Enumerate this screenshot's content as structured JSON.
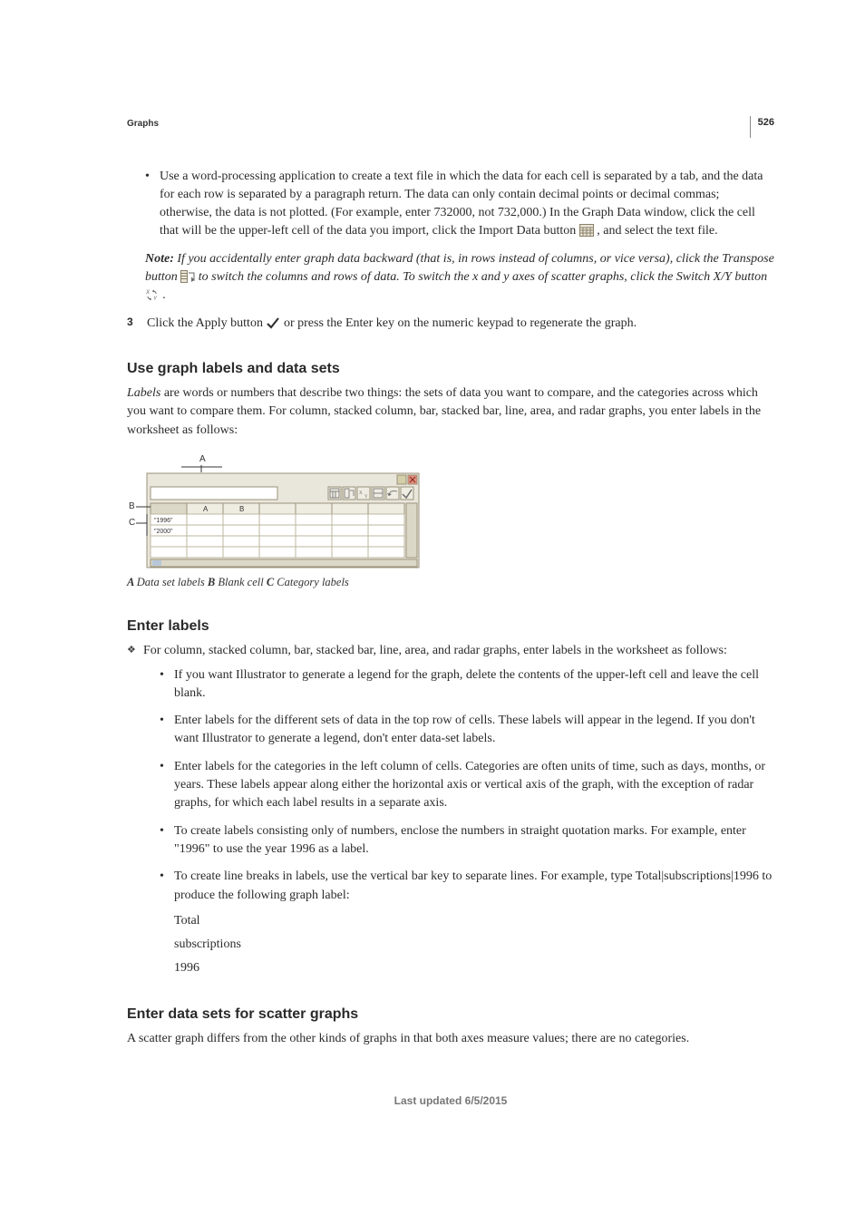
{
  "page_number": "526",
  "section_tag": "Graphs",
  "top_bullet": {
    "text_a": "Use a word-processing application to create a text file in which the data for each cell is separated by a tab, and the data for each row is separated by a paragraph return. The data can only contain decimal points or decimal commas; otherwise, the data is not plotted. (For example, enter 732000, not 732,000.) In the Graph Data window, click the cell that will be the upper-left cell of the data you import, click the Import Data button ",
    "text_b": ", and select the text file."
  },
  "note": {
    "label": "Note: ",
    "line1_a": "If you accidentally enter graph data backward (that is, in rows instead of columns, or vice versa), click the Transpose button ",
    "line1_b": " to switch the columns and rows of data. To switch the x and y axes of scatter graphs, click the Switch X/Y button ",
    "line1_c": " ."
  },
  "step3": {
    "num": "3",
    "text_a": "Click the Apply button ",
    "text_b": " or press the Enter key on the numeric keypad to regenerate the graph."
  },
  "h_use": "Use graph labels and data sets",
  "p_labels": {
    "term": "Labels",
    "rest": " are words or numbers that describe two things: the sets of data you want to compare, and the categories across which you want to compare them. For column, stacked column, bar, stacked bar, line, area, and radar graphs, you enter labels in the worksheet as follows:"
  },
  "figure": {
    "colA": "A",
    "colB": "B",
    "row1": "\"1996\"",
    "row2": "\"2000\"",
    "labelA": "A",
    "labelB": "B",
    "labelC": "C"
  },
  "figcap": {
    "a_b": "A ",
    "a_t": "Data set labels  ",
    "b_b": "B ",
    "b_t": "Blank cell  ",
    "c_b": "C ",
    "c_t": "Category labels"
  },
  "h_enter": "Enter labels",
  "diamond_lead": "For column, stacked column, bar, stacked bar, line, area, and radar graphs, enter labels in the worksheet as follows:",
  "inner": {
    "b1": "If you want Illustrator to generate a legend for the graph, delete the contents of the upper-left cell and leave the cell blank.",
    "b2": "Enter labels for the different sets of data in the top row of cells. These labels will appear in the legend. If you don't want Illustrator to generate a legend, don't enter data-set labels.",
    "b3": "Enter labels for the categories in the left column of cells. Categories are often units of time, such as days, months, or years. These labels appear along either the horizontal axis or vertical axis of the graph, with the exception of radar graphs, for which each label results in a separate axis.",
    "b4": "To create labels consisting only of numbers, enclose the numbers in straight quotation marks. For example, enter \"1996\" to use the year 1996 as a label.",
    "b5": "To create line breaks in labels, use the vertical bar key to separate lines. For example, type Total|subscriptions|1996 to produce the following graph label:",
    "s1": "Total",
    "s2": "subscriptions",
    "s3": "1996"
  },
  "h_scatter": "Enter data sets for scatter graphs",
  "p_scatter": "A scatter graph differs from the other kinds of graphs in that both axes measure values; there are no categories.",
  "footer": "Last updated 6/5/2015"
}
